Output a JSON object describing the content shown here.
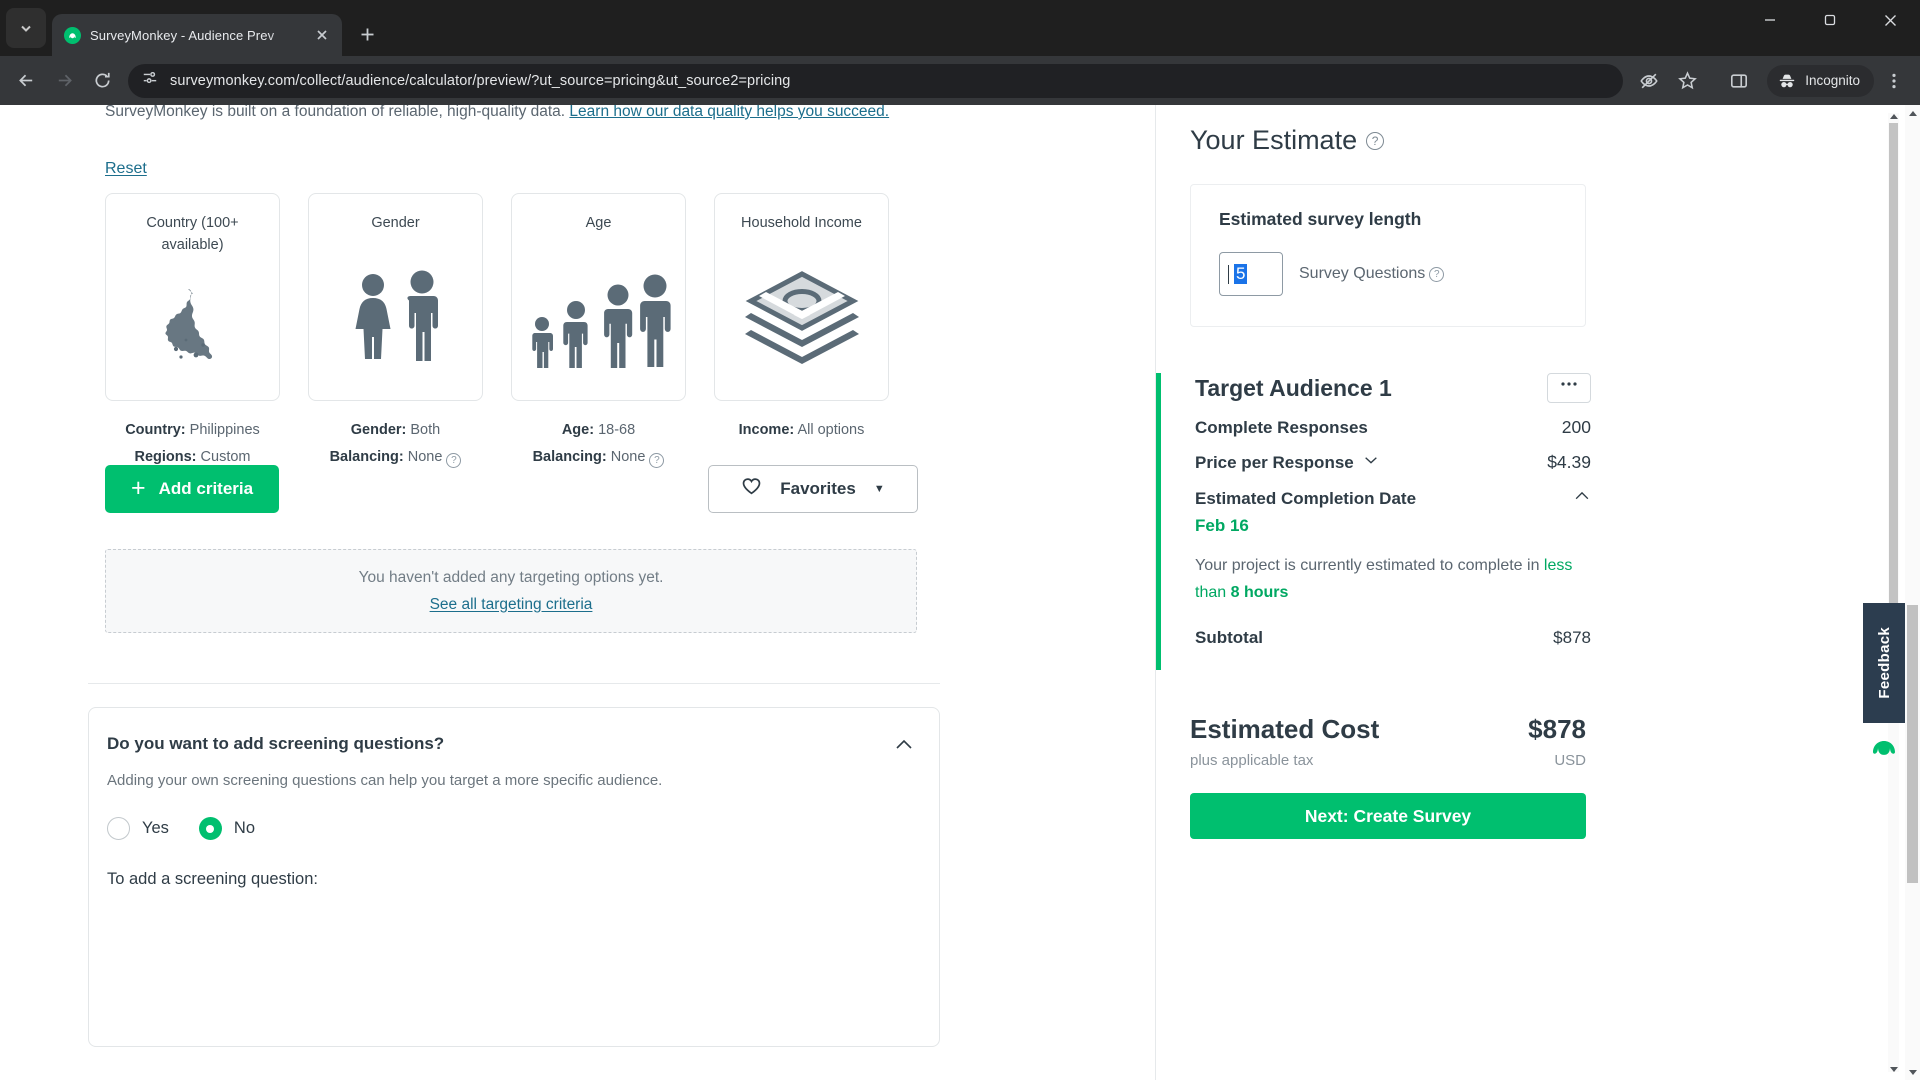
{
  "browser": {
    "tab": {
      "title": "SurveyMonkey - Audience Prev",
      "favicon": "surveymonkey-logo-icon",
      "close": "close-icon"
    },
    "newtab_label": "+",
    "window": {
      "minimize": "minimize-icon",
      "maximize": "maximize-icon",
      "close": "window-close-icon"
    },
    "nav": {
      "back": "back-arrow-icon",
      "forward": "forward-arrow-icon",
      "reload": "reload-icon"
    },
    "omnibox": {
      "site_info_icon": "page-info-icon",
      "url": "surveymonkey.com/collect/audience/calculator/preview/?ut_source=pricing&ut_source2=pricing"
    },
    "actions": {
      "tracking_protection_icon": "eye-slash-icon",
      "bookmark_icon": "star-icon",
      "side_panel_icon": "side-panel-icon",
      "incognito_icon": "incognito-hat-icon",
      "incognito_label": "Incognito",
      "menu_icon": "three-dot-menu-icon"
    }
  },
  "page": {
    "intro": {
      "cut_text": "SurveyMonkey is built on a foundation of reliable, high-quality data. ",
      "link_text": "Learn how our data quality helps you succeed."
    },
    "reset_label": "Reset",
    "criteria": [
      {
        "title": "Country (100+ available)",
        "icon": "philippines-map-icon",
        "meta": [
          {
            "label": "Country:",
            "value": "Philippines",
            "help": false
          },
          {
            "label": "Regions:",
            "value": "Custom",
            "help": false
          }
        ]
      },
      {
        "title": "Gender",
        "icon": "gender-people-icon",
        "meta": [
          {
            "label": "Gender:",
            "value": "Both",
            "help": false
          },
          {
            "label": "Balancing:",
            "value": "None",
            "help": true
          }
        ]
      },
      {
        "title": "Age",
        "icon": "age-people-icon",
        "meta": [
          {
            "label": "Age:",
            "value": "18-68",
            "help": false
          },
          {
            "label": "Balancing:",
            "value": "None",
            "help": true
          }
        ]
      },
      {
        "title": "Household Income",
        "icon": "money-stack-icon",
        "meta": [
          {
            "label": "Income:",
            "value": "All options",
            "help": false
          }
        ]
      }
    ],
    "add_criteria_label": "Add criteria",
    "favorites_label": "Favorites",
    "empty_state": {
      "message": "You haven't added any targeting options yet.",
      "link": "See all targeting criteria"
    },
    "screening": {
      "question": "Do you want to add screening questions?",
      "subtitle": "Adding your own screening questions can help you target a more specific audience.",
      "options": [
        {
          "label": "Yes",
          "selected": false
        },
        {
          "label": "No",
          "selected": true
        }
      ],
      "footer": "To add a screening question:",
      "collapse_icon": "chevron-up-icon"
    }
  },
  "estimate": {
    "title": "Your Estimate",
    "title_help_icon": "question-circle-icon",
    "length_card": {
      "title": "Estimated survey length",
      "input_value": "5",
      "input_selected": true,
      "unit_label": "Survey Questions",
      "help_icon": "question-circle-icon"
    },
    "audience": {
      "title": "Target Audience 1",
      "menu_label": "•••",
      "rows": [
        {
          "label": "Complete Responses",
          "value": "200",
          "chevron": ""
        },
        {
          "label": "Price per Response",
          "value": "$4.39",
          "chevron": "chevron-down-icon"
        }
      ],
      "completion": {
        "label": "Estimated Completion Date",
        "chevron": "chevron-up-icon",
        "date": "Feb 16",
        "note_prefix": "Your project is currently estimated to complete in",
        "note_highlight_light": "less than ",
        "note_highlight_bold": "8 hours"
      },
      "subtotal": {
        "label": "Subtotal",
        "value": "$878"
      }
    },
    "cost": {
      "label": "Estimated Cost",
      "value": "$878",
      "tax_note": "plus applicable tax",
      "currency": "USD"
    },
    "next_button": "Next: Create Survey"
  },
  "widgets": {
    "feedback_label": "Feedback",
    "feedback_logo_icon": "surveymonkey-logo-icon"
  },
  "colors": {
    "brand_green": "#00bf6f",
    "accent_teal": "#00a862",
    "link_blue": "#1c6e8c",
    "selection_blue": "#1a73e8",
    "dark_text": "#2f3c46"
  }
}
